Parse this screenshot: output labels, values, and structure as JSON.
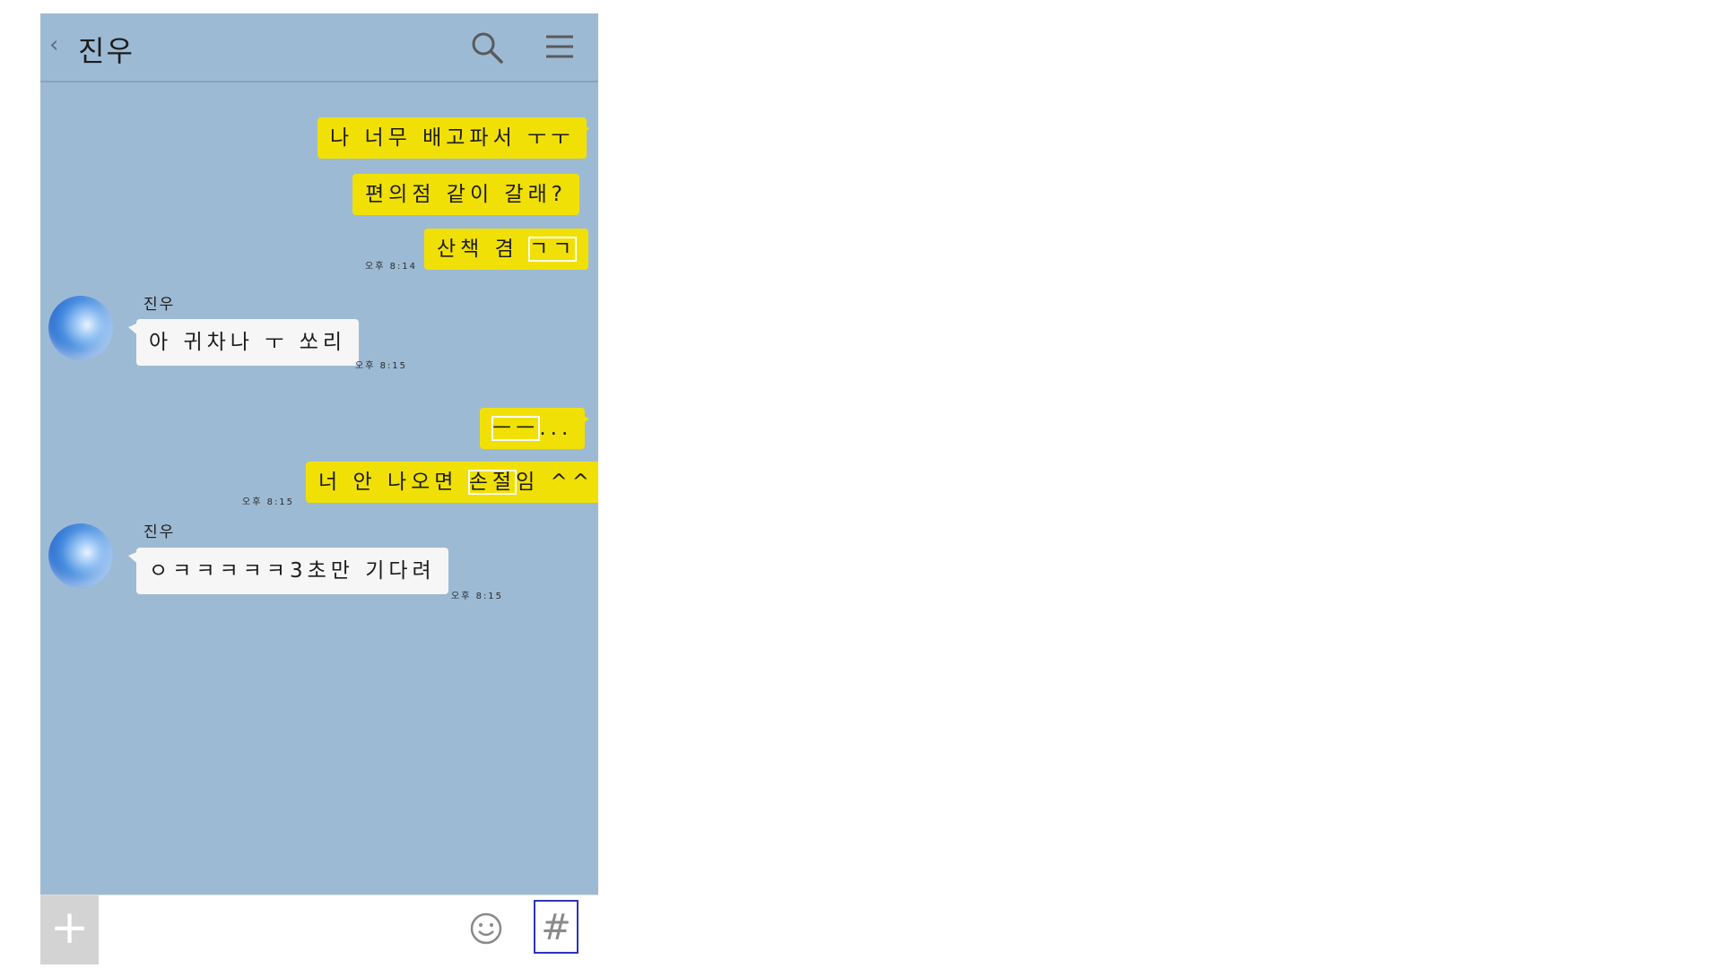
{
  "header": {
    "back": "‹",
    "title": "진우"
  },
  "messages": {
    "m1": "나 너무 배고파서 ㅜㅜ",
    "m2": "편의점 같이 갈래?",
    "m3a": "산책 겸 ",
    "m3b": "ㄱㄱ",
    "t1": "오후 8:14",
    "name1": "진우",
    "r1": "아 귀차나 ㅜ 쏘리",
    "t2": "오후 8:15",
    "m4a": "ㅡㅡ",
    "m4b": "...",
    "m5a": "너 안 나오면 ",
    "m5b": "손절",
    "m5c": "임 ^^",
    "t3": "오후 8:15",
    "name2": "진우",
    "r2": "ㅇㅋㅋㅋㅋㅋ3초만 기다려",
    "t4": "오후 8:15"
  },
  "bottom": {
    "plus": "+",
    "hash": "#"
  }
}
